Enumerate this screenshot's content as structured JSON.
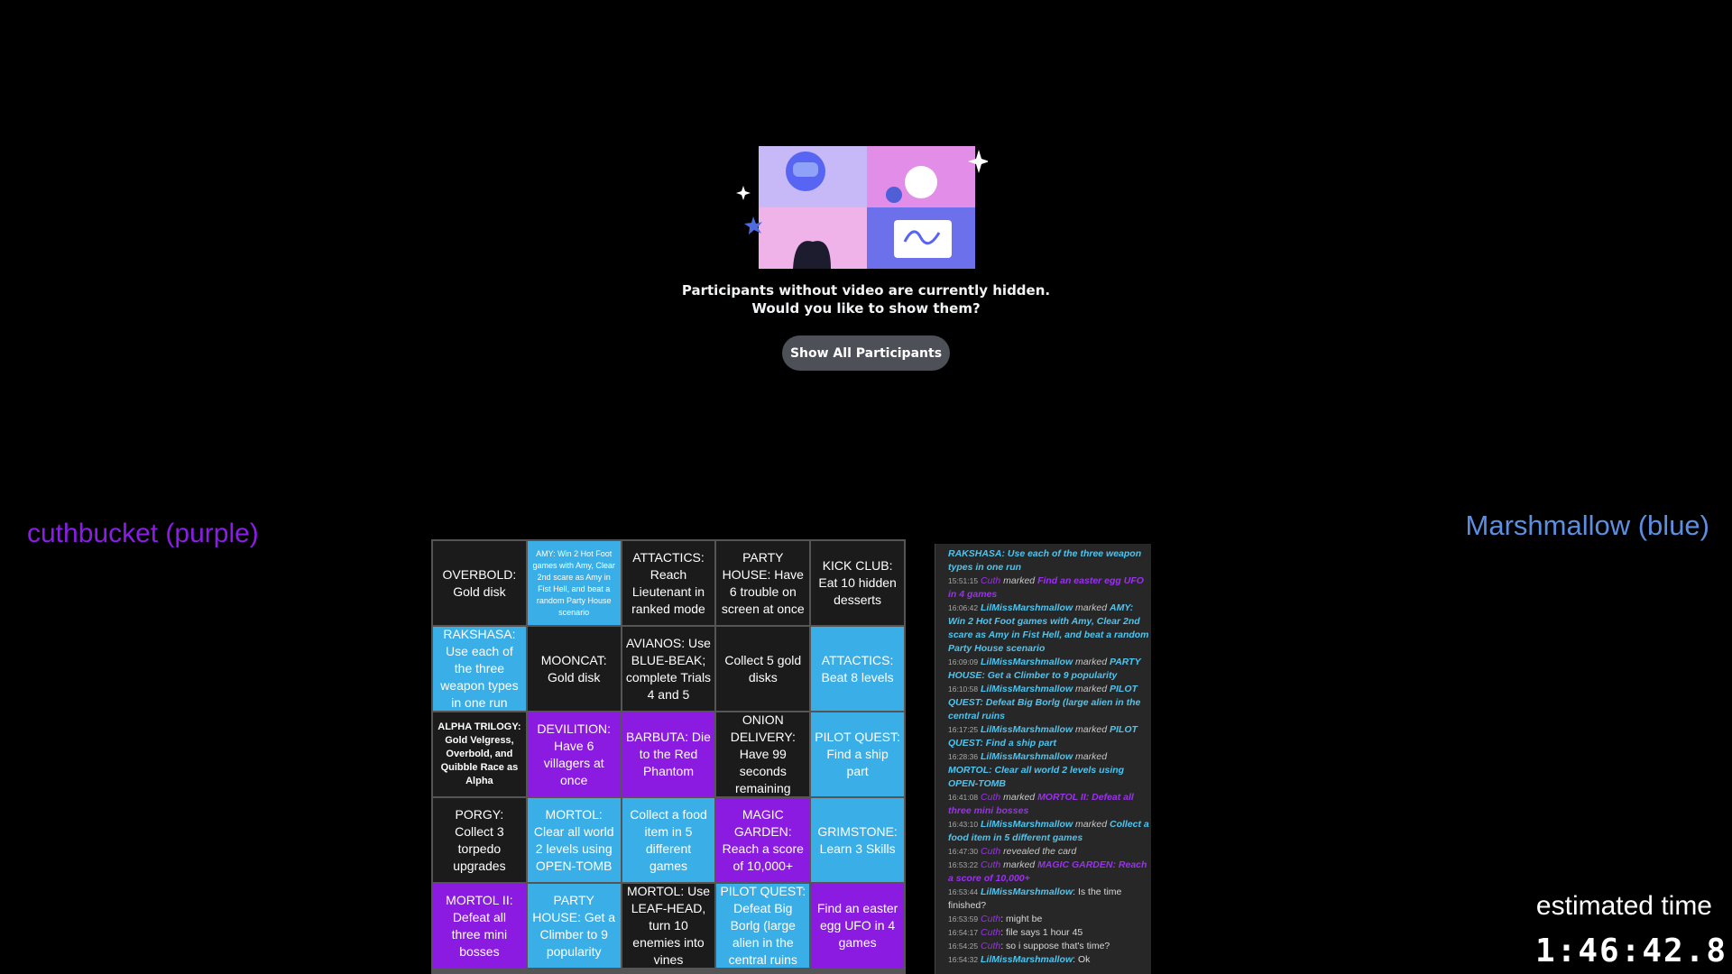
{
  "prompt": {
    "line1": "Participants without video are currently hidden.",
    "line2": "Would you like to show them?",
    "button": "Show All Participants"
  },
  "players": {
    "left": "cuthbucket (purple)",
    "right": "Marshmallow (blue)"
  },
  "timer": {
    "label": "estimated time",
    "value": "1:46:42.8"
  },
  "colors": {
    "purple": "#8b1be0",
    "blue": "#3aaee6",
    "unmarked": "#1b1b1b"
  },
  "board": {
    "cells": [
      {
        "text": "OVERBOLD: Gold disk",
        "state": "none",
        "size": "normal"
      },
      {
        "text": "AMY: Win 2 Hot Foot games with Amy, Clear 2nd scare as Amy in Fist Hell, and beat a random Party House scenario",
        "state": "blue",
        "size": "tiny"
      },
      {
        "text": "ATTACTICS: Reach Lieutenant in ranked mode",
        "state": "none",
        "size": "normal"
      },
      {
        "text": "PARTY HOUSE: Have 6 trouble on screen at once",
        "state": "none",
        "size": "normal"
      },
      {
        "text": "KICK CLUB: Eat 10 hidden desserts",
        "state": "none",
        "size": "normal"
      },
      {
        "text": "RAKSHASA: Use each of the three weapon types in one run",
        "state": "blue",
        "size": "normal"
      },
      {
        "text": "MOONCAT: Gold disk",
        "state": "none",
        "size": "normal"
      },
      {
        "text": "AVIANOS: Use BLUE-BEAK; complete Trials 4 and 5",
        "state": "none",
        "size": "normal"
      },
      {
        "text": "Collect 5 gold disks",
        "state": "none",
        "size": "normal"
      },
      {
        "text": "ATTACTICS: Beat 8 levels",
        "state": "blue",
        "size": "normal"
      },
      {
        "text": "ALPHA TRILOGY: Gold Velgress, Overbold, and Quibble Race as Alpha",
        "state": "none",
        "size": "small"
      },
      {
        "text": "DEVILITION: Have 6 villagers at once",
        "state": "purple",
        "size": "normal"
      },
      {
        "text": "BARBUTA: Die to the Red Phantom",
        "state": "purple",
        "size": "normal"
      },
      {
        "text": "ONION DELIVERY: Have 99 seconds remaining",
        "state": "none",
        "size": "normal"
      },
      {
        "text": "PILOT QUEST: Find a ship part",
        "state": "blue",
        "size": "normal"
      },
      {
        "text": "PORGY: Collect 3 torpedo upgrades",
        "state": "none",
        "size": "normal"
      },
      {
        "text": "MORTOL: Clear all world 2 levels using OPEN-TOMB",
        "state": "blue",
        "size": "normal"
      },
      {
        "text": "Collect a food item in 5 different games",
        "state": "blue",
        "size": "normal"
      },
      {
        "text": "MAGIC GARDEN: Reach a score of 10,000+",
        "state": "purple",
        "size": "normal"
      },
      {
        "text": "GRIMSTONE: Learn 3 Skills",
        "state": "blue",
        "size": "normal"
      },
      {
        "text": "MORTOL II: Defeat all three mini bosses",
        "state": "purple",
        "size": "normal"
      },
      {
        "text": "PARTY HOUSE: Get a Climber to 9 popularity",
        "state": "blue",
        "size": "normal"
      },
      {
        "text": "MORTOL: Use LEAF-HEAD, turn 10 enemies into vines",
        "state": "none",
        "size": "normal"
      },
      {
        "text": "PILOT QUEST: Defeat Big Borlg (large alien in the central ruins",
        "state": "blue",
        "size": "normal"
      },
      {
        "text": "Find an easter egg UFO in 4 games",
        "state": "purple",
        "size": "normal"
      }
    ]
  },
  "log": {
    "entries": [
      {
        "t": "",
        "name": "",
        "nameClass": "",
        "verb": "",
        "item": "RAKSHASA: Use each of the three weapon types in one run",
        "itemClass": "b"
      },
      {
        "t": "15:51:15",
        "name": "Cuth",
        "nameClass": "p",
        "verb": "marked",
        "item": "Find an easter egg UFO in 4 games",
        "itemClass": "pb"
      },
      {
        "t": "16:06:42",
        "name": "LilMissMarshmallow",
        "nameClass": "b",
        "verb": "marked",
        "item": "AMY: Win 2 Hot Foot games with Amy, Clear 2nd scare as Amy in Fist Hell, and beat a random Party House scenario",
        "itemClass": "b"
      },
      {
        "t": "16:09:09",
        "name": "LilMissMarshmallow",
        "nameClass": "b",
        "verb": "marked",
        "item": "PARTY HOUSE: Get a Climber to 9 popularity",
        "itemClass": "b"
      },
      {
        "t": "16:10:58",
        "name": "LilMissMarshmallow",
        "nameClass": "b",
        "verb": "marked",
        "item": "PILOT QUEST: Defeat Big Borlg (large alien in the central ruins",
        "itemClass": "b"
      },
      {
        "t": "16:17:25",
        "name": "LilMissMarshmallow",
        "nameClass": "b",
        "verb": "marked",
        "item": "PILOT QUEST: Find a ship part",
        "itemClass": "b"
      },
      {
        "t": "16:28:36",
        "name": "LilMissMarshmallow",
        "nameClass": "b",
        "verb": "marked",
        "item": "MORTOL: Clear all world 2 levels using OPEN-TOMB",
        "itemClass": "b"
      },
      {
        "t": "16:41:08",
        "name": "Cuth",
        "nameClass": "p",
        "verb": "marked",
        "item": "MORTOL II: Defeat all three mini bosses",
        "itemClass": "pb"
      },
      {
        "t": "16:43:10",
        "name": "LilMissMarshmallow",
        "nameClass": "b",
        "verb": "marked",
        "item": "Collect a food item in 5 different games",
        "itemClass": "b"
      },
      {
        "t": "16:47:30",
        "name": "Cuth",
        "nameClass": "p",
        "verb": "revealed the card",
        "item": "",
        "itemClass": ""
      },
      {
        "t": "16:53:22",
        "name": "Cuth",
        "nameClass": "p",
        "verb": "marked",
        "item": "MAGIC GARDEN: Reach a score of 10,000+",
        "itemClass": "pb"
      },
      {
        "t": "16:53:44",
        "name": "LilMissMarshmallow",
        "nameClass": "b",
        "verb": ": Is the time finished?",
        "item": "",
        "itemClass": ""
      },
      {
        "t": "16:53:59",
        "name": "Cuth",
        "nameClass": "p",
        "verb": ": might be",
        "item": "",
        "itemClass": ""
      },
      {
        "t": "16:54:17",
        "name": "Cuth",
        "nameClass": "p",
        "verb": ": file says 1 hour 45",
        "item": "",
        "itemClass": ""
      },
      {
        "t": "16:54:25",
        "name": "Cuth",
        "nameClass": "p",
        "verb": ": so i suppose that's time?",
        "item": "",
        "itemClass": ""
      },
      {
        "t": "16:54:32",
        "name": "LilMissMarshmallow",
        "nameClass": "b",
        "verb": ": Ok",
        "item": "",
        "itemClass": ""
      }
    ]
  }
}
